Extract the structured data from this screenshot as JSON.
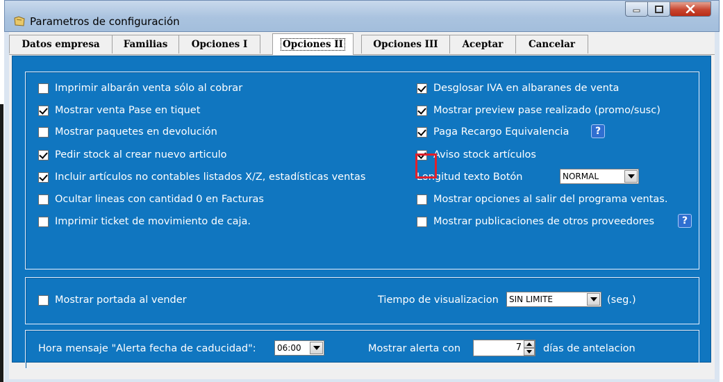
{
  "window": {
    "title": "Parametros de configuración"
  },
  "tabs": [
    {
      "label": "Datos empresa"
    },
    {
      "label": "Familias"
    },
    {
      "label": "Opciones I"
    },
    {
      "label": "Opciones II",
      "active": true
    },
    {
      "label": "Opciones III"
    },
    {
      "label": "Aceptar"
    },
    {
      "label": "Cancelar"
    }
  ],
  "options_left": [
    {
      "label": "Imprimir albarán venta sólo al cobrar",
      "checked": false
    },
    {
      "label": "Mostrar venta Pase en tiquet",
      "checked": true
    },
    {
      "label": "Mostrar paquetes en devolución",
      "checked": false
    },
    {
      "label": "Pedir stock al crear nuevo articulo",
      "checked": true
    },
    {
      "label": "Incluir artículos no contables listados X/Z, estadísticas ventas",
      "checked": true
    },
    {
      "label": "Ocultar lineas con cantidad 0 en Facturas",
      "checked": false
    },
    {
      "label": "Imprimir ticket de movimiento de caja.",
      "checked": false
    }
  ],
  "options_right": [
    {
      "label": "Desglosar IVA en albaranes de venta",
      "checked": true
    },
    {
      "label": "Mostrar preview pase realizado (promo/susc)",
      "checked": true
    },
    {
      "label": "Paga Recargo Equivalencia",
      "checked": true
    },
    {
      "label": "Aviso stock artículos",
      "checked": true
    }
  ],
  "longitud_texto": {
    "label": "Longitud texto Botón",
    "value": "NORMAL"
  },
  "options_right_bottom": [
    {
      "label": "Mostrar opciones al salir del programa ventas.",
      "checked": false
    },
    {
      "label": "Mostrar publicaciones de otros proveedores",
      "checked": false
    }
  ],
  "help_icon_text": "?",
  "portada": {
    "label": "Mostrar portada al vender",
    "checked": false
  },
  "tiempo": {
    "label": "Tiempo de visualizacion",
    "value": "SIN LIMITE",
    "unit": "(seg.)"
  },
  "alerta": {
    "hora_label": "Hora mensaje \"Alerta fecha de caducidad\":",
    "hora_value": "06:00",
    "mostrar_label": "Mostrar alerta con",
    "dias_value": "7",
    "dias_label": "días de antelacion"
  },
  "colors": {
    "panel": "#1076c0",
    "highlight": "#e0202c"
  }
}
